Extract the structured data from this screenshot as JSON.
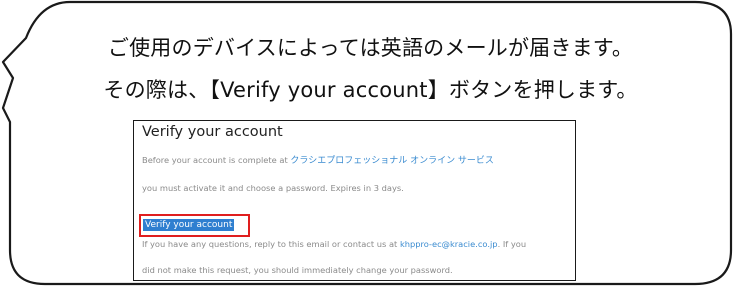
{
  "instruction": {
    "line1": "ご使用のデバイスによっては英語のメールが届きます。",
    "line2": "その際は、【Verify your account】ボタンを押します。"
  },
  "email": {
    "heading": "Verify your account",
    "body_line1_prefix": "Before your account is complete at ",
    "service_name": "クラシエプロフェッショナル オンライン サービス",
    "body_line2": "you must activate it and choose a password. Expires in 3 days.",
    "verify_link": "Verify your account",
    "body_line4_prefix": "If you have any questions, reply to this email or contact us at ",
    "contact_email": "khppro-ec@kracie.co.jp",
    "body_line4_suffix": ". If you",
    "body_line5": "did not make this request, you should immediately change your password."
  },
  "colors": {
    "link": "#3a8bd0",
    "highlight_border": "#e01e1e",
    "selected_link_background": "#2f7fd0",
    "bubble_border": "#1a1a1a"
  }
}
